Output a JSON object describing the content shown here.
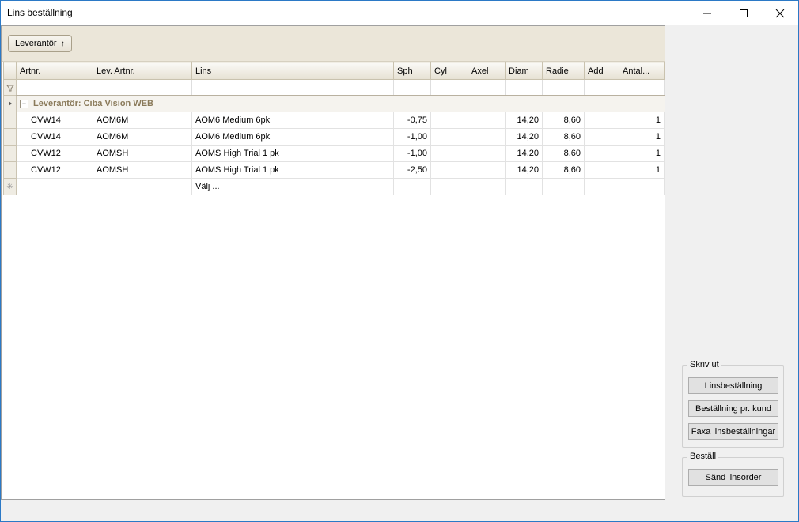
{
  "window": {
    "title": "Lins beställning"
  },
  "groupbar": {
    "chip_label": "Leverantör"
  },
  "grid": {
    "columns": [
      "Artnr.",
      "Lev. Artnr.",
      "Lins",
      "Sph",
      "Cyl",
      "Axel",
      "Diam",
      "Radie",
      "Add",
      "Antal..."
    ],
    "group_label": "Leverantör: Ciba Vision WEB",
    "rows": [
      {
        "artnr": "CVW14",
        "lev_artnr": "AOM6M",
        "lins": "AOM6 Medium 6pk",
        "sph": "-0,75",
        "cyl": "",
        "axel": "",
        "diam": "14,20",
        "radie": "8,60",
        "add": "",
        "antal": "1"
      },
      {
        "artnr": "CVW14",
        "lev_artnr": "AOM6M",
        "lins": "AOM6 Medium 6pk",
        "sph": "-1,00",
        "cyl": "",
        "axel": "",
        "diam": "14,20",
        "radie": "8,60",
        "add": "",
        "antal": "1"
      },
      {
        "artnr": "CVW12",
        "lev_artnr": "AOMSH",
        "lins": "AOMS High Trial 1 pk",
        "sph": "-1,00",
        "cyl": "",
        "axel": "",
        "diam": "14,20",
        "radie": "8,60",
        "add": "",
        "antal": "1"
      },
      {
        "artnr": "CVW12",
        "lev_artnr": "AOMSH",
        "lins": "AOMS High Trial 1 pk",
        "sph": "-2,50",
        "cyl": "",
        "axel": "",
        "diam": "14,20",
        "radie": "8,60",
        "add": "",
        "antal": "1"
      }
    ],
    "new_row_text": "Välj ..."
  },
  "print_box": {
    "legend": "Skriv ut",
    "buttons": [
      "Linsbeställning",
      "Beställning pr. kund",
      "Faxa linsbeställningar"
    ]
  },
  "order_box": {
    "legend": "Beställ",
    "button": "Sänd linsorder"
  }
}
